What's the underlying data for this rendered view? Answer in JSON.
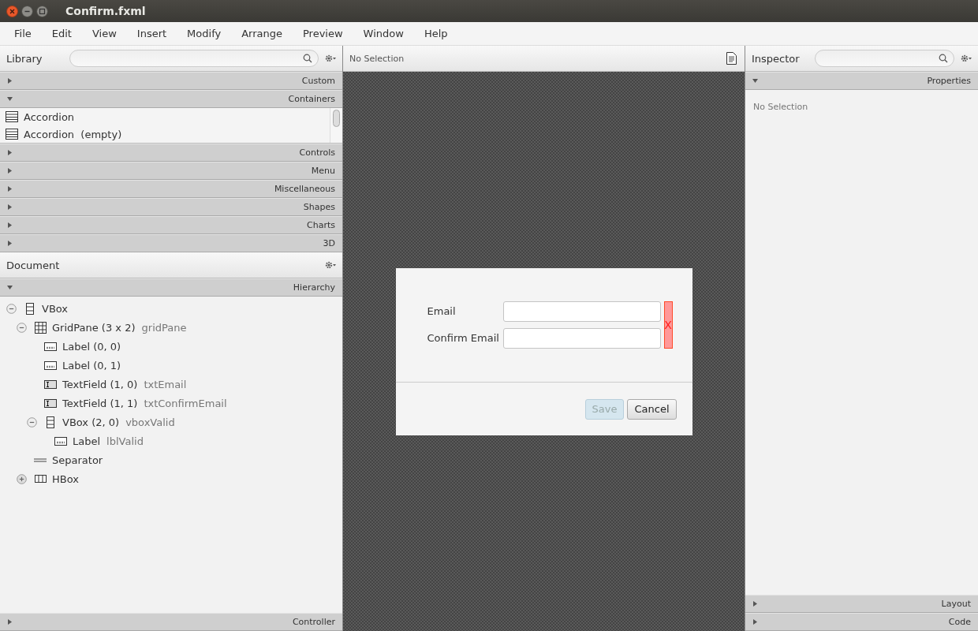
{
  "window": {
    "title": "Confirm.fxml"
  },
  "menu": [
    "File",
    "Edit",
    "View",
    "Insert",
    "Modify",
    "Arrange",
    "Preview",
    "Window",
    "Help"
  ],
  "library": {
    "title": "Library",
    "sections": [
      {
        "label": "Custom",
        "expanded": false
      },
      {
        "label": "Containers",
        "expanded": true,
        "items": [
          {
            "label": "Accordion"
          },
          {
            "label": "Accordion  (empty)"
          }
        ]
      },
      {
        "label": "Controls",
        "expanded": false
      },
      {
        "label": "Menu",
        "expanded": false
      },
      {
        "label": "Miscellaneous",
        "expanded": false
      },
      {
        "label": "Shapes",
        "expanded": false
      },
      {
        "label": "Charts",
        "expanded": false
      },
      {
        "label": "3D",
        "expanded": false
      }
    ]
  },
  "document": {
    "title": "Document",
    "hierarchy": {
      "label": "Hierarchy",
      "expanded": true,
      "tree": [
        {
          "kind": "vbox",
          "name": "VBox",
          "expanded": true,
          "children": [
            {
              "kind": "gridpane",
              "name": "GridPane (3 x 2)",
              "fx_id": "gridPane",
              "expanded": true,
              "children": [
                {
                  "kind": "label",
                  "name": "Label (0, 0)"
                },
                {
                  "kind": "label",
                  "name": "Label (0, 1)"
                },
                {
                  "kind": "textfield",
                  "name": "TextField (1, 0)",
                  "fx_id": "txtEmail"
                },
                {
                  "kind": "textfield",
                  "name": "TextField (1, 1)",
                  "fx_id": "txtConfirmEmail"
                },
                {
                  "kind": "vbox",
                  "name": "VBox (2, 0)",
                  "fx_id": "vboxValid",
                  "expanded": true,
                  "children": [
                    {
                      "kind": "label",
                      "name": "Label",
                      "fx_id": "lblValid"
                    }
                  ]
                }
              ]
            },
            {
              "kind": "separator",
              "name": "Separator"
            },
            {
              "kind": "hbox",
              "name": "HBox",
              "expanded": false
            }
          ]
        }
      ]
    },
    "controller": {
      "label": "Controller",
      "expanded": false
    }
  },
  "canvas": {
    "header": "No Selection",
    "dialog": {
      "fields": [
        {
          "label": "Email"
        },
        {
          "label": "Confirm Email"
        }
      ],
      "validation": {
        "text": "X",
        "valid": false
      },
      "buttons": [
        {
          "label": "Save",
          "disabled": true
        },
        {
          "label": "Cancel",
          "disabled": false
        }
      ]
    }
  },
  "inspector": {
    "title": "Inspector",
    "sections": [
      {
        "label": "Properties",
        "expanded": true,
        "content": "No Selection"
      },
      {
        "label": "Layout",
        "expanded": false
      },
      {
        "label": "Code",
        "expanded": false
      }
    ]
  }
}
